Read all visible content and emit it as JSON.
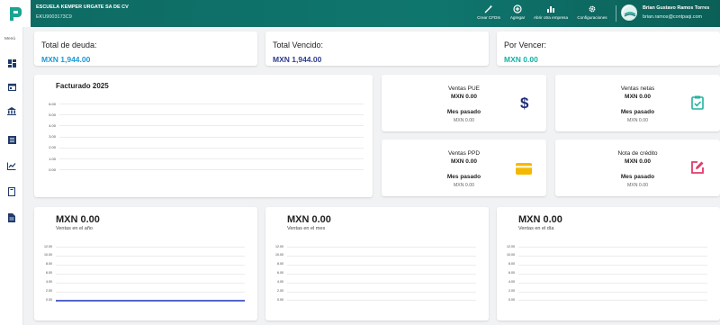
{
  "header": {
    "company": "ESCUELA KEMPER URGATE SA DE CV",
    "rfc": "EKU9003173C9",
    "tools": [
      {
        "label": "Crear CFDIs",
        "icon": "magic-wand-icon"
      },
      {
        "label": "Agregar",
        "icon": "add-circle-icon"
      },
      {
        "label": "Abrir otra empresa",
        "icon": "bar-chart-icon"
      },
      {
        "label": "Configuraciones",
        "icon": "gear-icon"
      }
    ],
    "user_name": "Brian Gustavo Ramos Torres",
    "user_email": "brian.ramos@contpaqi.com"
  },
  "sidebar": {
    "menu_label": "Menú",
    "items": [
      "dashboard-icon",
      "calendar-icon",
      "bank-icon",
      "list-icon",
      "trend-chart-icon",
      "book-icon",
      "document-icon"
    ]
  },
  "summary": [
    {
      "label": "Total de deuda:",
      "value": "MXN 1,944.00",
      "color": "#1a9ad6"
    },
    {
      "label": "Total Vencido:",
      "value": "MXN 1,944.00",
      "color": "#2f3c8f"
    },
    {
      "label": "Por Vencer:",
      "value": "MXN 0.00",
      "color": "#12b3a6"
    }
  ],
  "facturado": {
    "title": "Facturado 2025",
    "ticks": [
      "6.00",
      "5.00",
      "4.00",
      "3.00",
      "2.00",
      "1.00",
      "0.00"
    ]
  },
  "stats": [
    {
      "title": "Ventas PUE",
      "value": "MXN 0.00",
      "prev_label": "Mes pasado",
      "prev_value": "MXN 0.00",
      "icon": "dollar-icon",
      "icon_color": "#1f2f7a"
    },
    {
      "title": "Ventas netas",
      "value": "MXN 0.00",
      "prev_label": "Mes pasado",
      "prev_value": "MXN 0.00",
      "icon": "clipboard-check-icon",
      "icon_color": "#22b3a0"
    },
    {
      "title": "Ventas PPD",
      "value": "MXN 0.00",
      "prev_label": "Mes pasado",
      "prev_value": "MXN 0.00",
      "icon": "credit-card-icon",
      "icon_color": "#f5b800"
    },
    {
      "title": "Nota de crédito",
      "value": "MXN 0.00",
      "prev_label": "Mes pasado",
      "prev_value": "MXN 0.00",
      "icon": "edit-icon",
      "icon_color": "#e23a6a"
    }
  ],
  "bottom": [
    {
      "value": "MXN 0.00",
      "label": "Ventas en el año",
      "ticks": [
        "12.00",
        "10.00",
        "8.00",
        "6.00",
        "4.00",
        "2.00",
        "0.00"
      ]
    },
    {
      "value": "MXN 0.00",
      "label": "Ventas en el mes",
      "ticks": [
        "12.00",
        "10.00",
        "8.00",
        "6.00",
        "4.00",
        "2.00",
        "0.00"
      ]
    },
    {
      "value": "MXN 0.00",
      "label": "Ventas en el día",
      "ticks": [
        "12.00",
        "10.00",
        "8.00",
        "6.00",
        "4.00",
        "2.00",
        "0.00"
      ]
    }
  ]
}
